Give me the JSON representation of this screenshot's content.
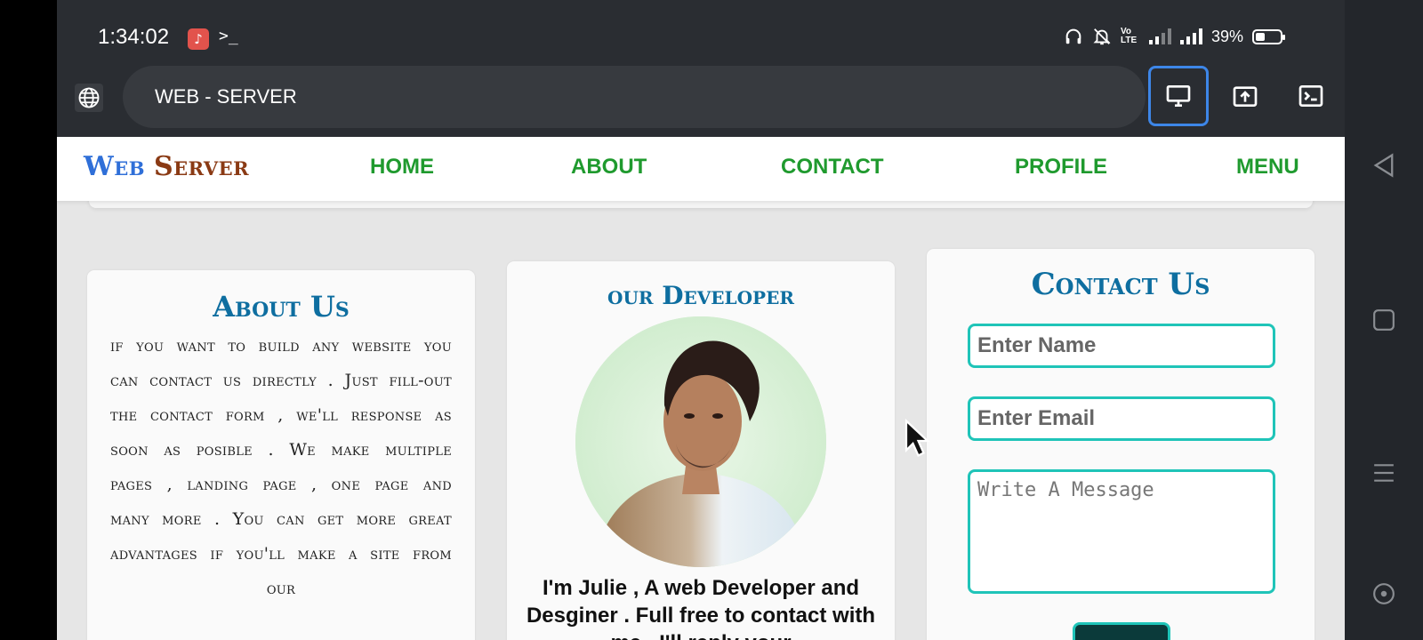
{
  "status_bar": {
    "time": "1:34:02",
    "battery_text": "39%",
    "battery_level": 0.39,
    "volte_label": "Vo\nLTE",
    "icons": [
      "music-app-icon",
      "terminal-icon",
      "headphones-icon",
      "mute-icon",
      "volte-icon",
      "signal-icon",
      "signal-icon",
      "battery-icon"
    ]
  },
  "browser": {
    "url_title": "WEB - SERVER",
    "icons": [
      "globe-icon",
      "desktop-icon",
      "share-icon",
      "terminal-icon"
    ],
    "active_color": "#3d86e8"
  },
  "site": {
    "logo_web": "Web",
    "logo_server": "Server",
    "nav": [
      "HOME",
      "ABOUT",
      "CONTACT",
      "PROFILE",
      "MENU"
    ],
    "nav_color": "#1f9a2e"
  },
  "about": {
    "title": "About Us",
    "text": "if you want to build any website you can contact us directly . Just fill-out the contact form , we'll response as soon as posible . We make multiple pages , landing page , one page and many more . You can get more great advantages if you'll make a site from our"
  },
  "developer": {
    "title": "our Developer",
    "text": "I'm Julie , A web Developer and Desginer . Full free to contact with me . I'll reply your"
  },
  "contact": {
    "title": "Contact Us",
    "name_placeholder": "Enter Name",
    "email_placeholder": "Enter Email",
    "message_placeholder": "Write A Message",
    "accent_color": "#1fc4b8"
  },
  "android_nav": [
    "back-icon",
    "home-square-icon",
    "menu-lines-icon",
    "assistant-icon"
  ]
}
